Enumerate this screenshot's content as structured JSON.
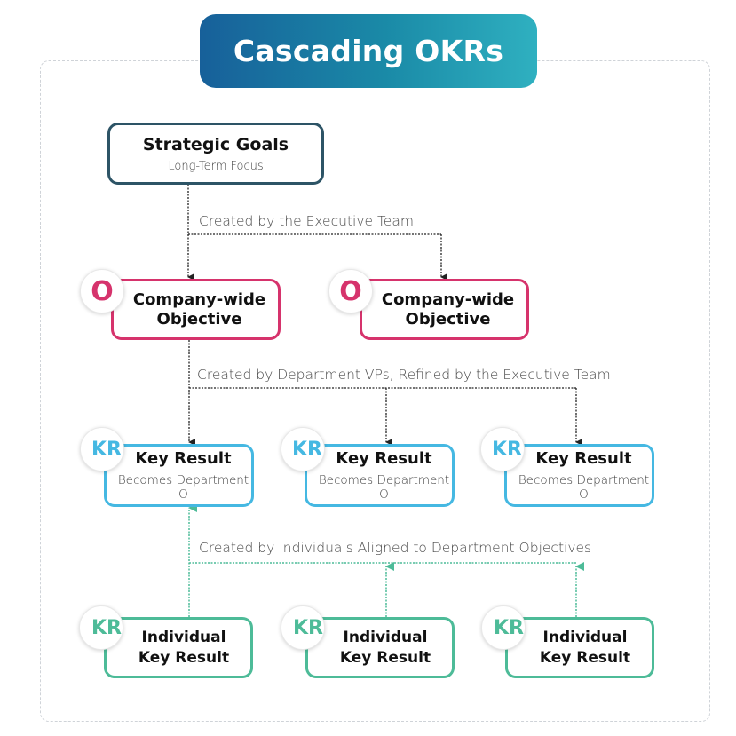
{
  "title": "Cascading OKRs",
  "colors": {
    "title_gradient_start": "#17609a",
    "title_gradient_end": "#2fb0c0",
    "strategic_border": "#2d5466",
    "objective": "#d6336c",
    "key_result": "#45b8e2",
    "individual_key_result": "#4dbb98",
    "frame_dashed": "#cfd3d8"
  },
  "strategic_goals": {
    "title": "Strategic Goals",
    "subtitle": "Long-Term Focus"
  },
  "connectors": {
    "level1_label": "Created by the Executive Team",
    "level2_label": "Created by Department VPs, Refined by the Executive Team",
    "level3_label": "Created by Individuals Aligned to Department Objectives"
  },
  "objectives": [
    {
      "badge": "O",
      "title_line1": "Company-wide",
      "title_line2": "Objective"
    },
    {
      "badge": "O",
      "title_line1": "Company-wide",
      "title_line2": "Objective"
    }
  ],
  "key_results": [
    {
      "badge": "KR",
      "title": "Key Result",
      "subtitle": "Becomes Department O"
    },
    {
      "badge": "KR",
      "title": "Key Result",
      "subtitle": "Becomes Department O"
    },
    {
      "badge": "KR",
      "title": "Key Result",
      "subtitle": "Becomes Department O"
    }
  ],
  "individual_key_results": [
    {
      "badge": "KR",
      "title_line1": "Individual",
      "title_line2": "Key Result"
    },
    {
      "badge": "KR",
      "title_line1": "Individual",
      "title_line2": "Key Result"
    },
    {
      "badge": "KR",
      "title_line1": "Individual",
      "title_line2": "Key Result"
    }
  ]
}
